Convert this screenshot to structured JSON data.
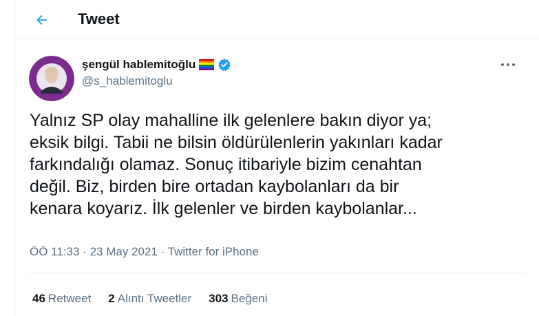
{
  "header": {
    "title": "Tweet",
    "back_icon": "arrow-left-icon"
  },
  "author": {
    "display_name": "şengül hablemitoğlu",
    "handle": "@s_hablemitoglu",
    "flag_icon": "rainbow-flag-icon",
    "verified_icon": "verified-badge-icon"
  },
  "tweet": {
    "text": "Yalnız SP olay mahalline ilk gelenlere bakın diyor ya;\neksik bilgi. Tabii ne bilsin öldürülenlerin yakınları kadar\nfarkındalığı olamaz. Sonuç itibariyle bizim cenahtan\ndeğil. Biz, birden bire ortadan kaybolanları da bir\nkenara koyarız. İlk gelenler ve birden kaybolanlar..."
  },
  "meta": {
    "time": "ÖÖ 11:33",
    "sep1": " · ",
    "date": "23 May 2021",
    "sep2": " · ",
    "source": "Twitter for iPhone"
  },
  "stats": {
    "retweets_count": "46",
    "retweets_label": "Retweet",
    "quotes_count": "2",
    "quotes_label": "Alıntı Tweetler",
    "likes_count": "303",
    "likes_label": "Beğeni"
  },
  "colors": {
    "accent": "#1da1f2",
    "text": "#0f1419",
    "secondary": "#5b7083",
    "border": "#e6ecf0"
  }
}
